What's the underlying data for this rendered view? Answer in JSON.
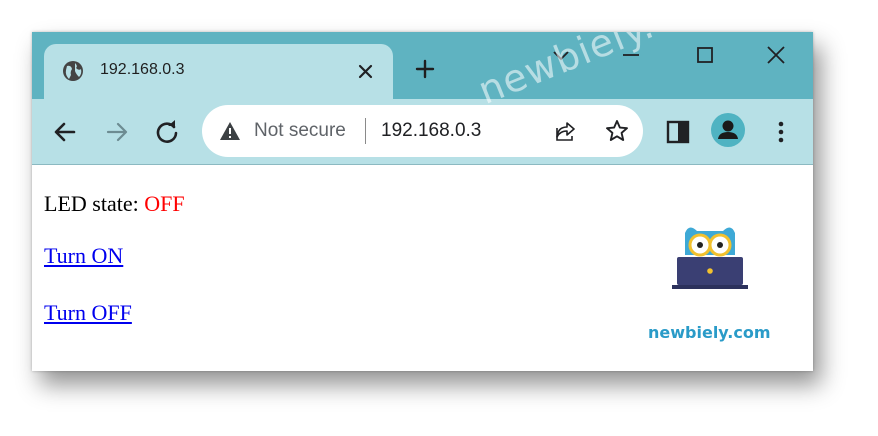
{
  "tab": {
    "title": "192.168.0.3"
  },
  "omnibox": {
    "security_label": "Not secure",
    "url": "192.168.0.3"
  },
  "watermark": "newbiely.com",
  "page": {
    "led_label": "LED state:",
    "led_value": "OFF",
    "turn_on_link": "Turn ON",
    "turn_off_link": "Turn OFF"
  },
  "logo": {
    "text": "newbiely.com"
  },
  "colors": {
    "titlebar": "#5fb3c1",
    "toolbar": "#b7e0e6",
    "link": "#0000ee",
    "led_off": "#ff0000",
    "logo_text": "#2a9bc8"
  },
  "icons": [
    "globe-icon",
    "close-icon",
    "plus-icon",
    "chevron-down-icon",
    "minimize-icon",
    "maximize-icon",
    "close-window-icon",
    "back-arrow-icon",
    "forward-arrow-icon",
    "reload-icon",
    "warning-icon",
    "share-icon",
    "star-icon",
    "side-panel-icon",
    "profile-icon",
    "menu-dots-icon"
  ]
}
